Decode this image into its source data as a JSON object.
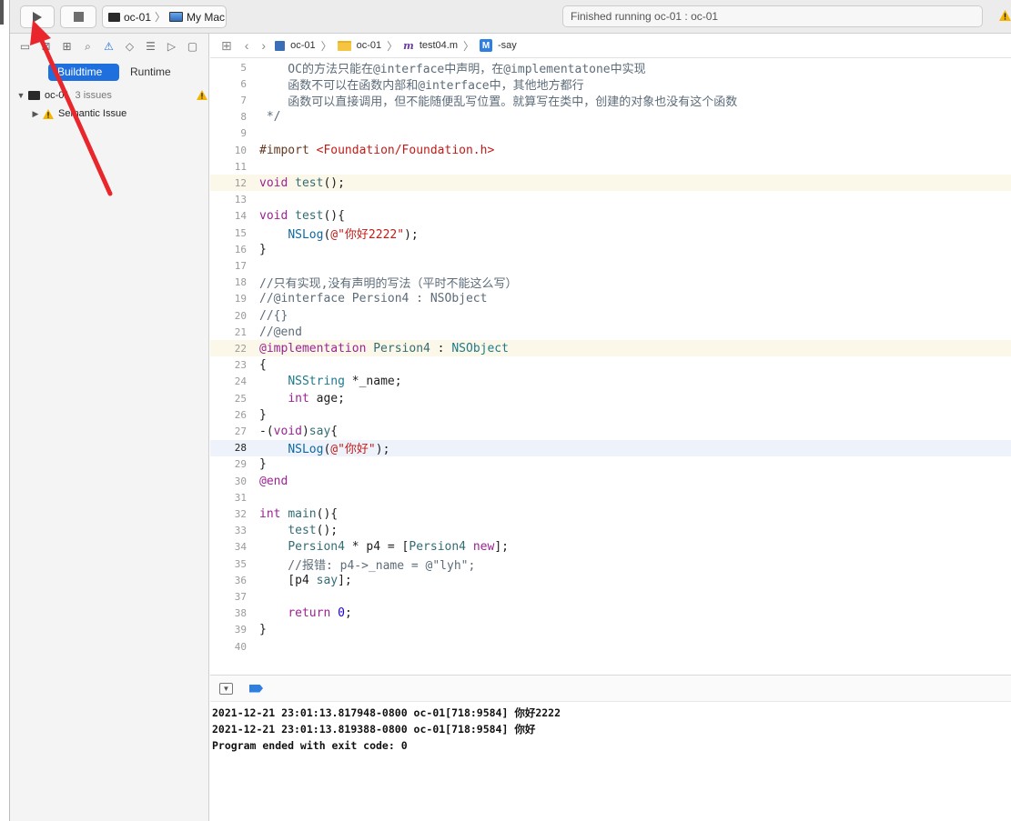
{
  "toolbar": {
    "scheme_target": "oc-01",
    "scheme_device": "My Mac",
    "status": "Finished running oc-01 : oc-01"
  },
  "navigator": {
    "tabs": {
      "buildtime": "Buildtime (3)",
      "runtime": "Runtime"
    },
    "project": {
      "name": "oc-01",
      "issues": "3 issues"
    },
    "issue_group": "Semantic Issue"
  },
  "jumpbar": {
    "crumbs": [
      "oc-01",
      "oc-01",
      "test04.m",
      "-say"
    ]
  },
  "editor": {
    "current_line": 28,
    "lines": [
      {
        "n": "5",
        "t": "    OC的方法只能在@interface中声明，在@implementatone中实现"
      },
      {
        "n": "6",
        "t": "    函数不可以在函数内部和@interface中，其他地方都行"
      },
      {
        "n": "7",
        "t": "    函数可以直接调用，但不能随便乱写位置。就算写在类中，创建的对象也没有这个函数"
      },
      {
        "n": "8",
        "t": " */"
      },
      {
        "n": "9",
        "t": ""
      },
      {
        "n": "10",
        "t": "#import <Foundation/Foundation.h>"
      },
      {
        "n": "11",
        "t": ""
      },
      {
        "n": "12",
        "t": "void test();"
      },
      {
        "n": "13",
        "t": ""
      },
      {
        "n": "14",
        "t": "void test(){"
      },
      {
        "n": "15",
        "t": "    NSLog(@\"你好2222\");"
      },
      {
        "n": "16",
        "t": "}"
      },
      {
        "n": "17",
        "t": ""
      },
      {
        "n": "18",
        "t": "//只有实现,没有声明的写法（平时不能这么写）"
      },
      {
        "n": "19",
        "t": "//@interface Persion4 : NSObject"
      },
      {
        "n": "20",
        "t": "//{}"
      },
      {
        "n": "21",
        "t": "//@end"
      },
      {
        "n": "22",
        "t": "@implementation Persion4 : NSObject"
      },
      {
        "n": "23",
        "t": "{"
      },
      {
        "n": "24",
        "t": "    NSString *_name;"
      },
      {
        "n": "25",
        "t": "    int age;"
      },
      {
        "n": "26",
        "t": "}"
      },
      {
        "n": "27",
        "t": "-(void)say{"
      },
      {
        "n": "28",
        "t": "    NSLog(@\"你好\");"
      },
      {
        "n": "29",
        "t": "}"
      },
      {
        "n": "30",
        "t": "@end"
      },
      {
        "n": "31",
        "t": ""
      },
      {
        "n": "32",
        "t": "int main(){"
      },
      {
        "n": "33",
        "t": "    test();"
      },
      {
        "n": "34",
        "t": "    Persion4 * p4 = [Persion4 new];"
      },
      {
        "n": "35",
        "t": "    //报错: p4->_name = @\"lyh\";"
      },
      {
        "n": "36",
        "t": "    [p4 say];"
      },
      {
        "n": "37",
        "t": ""
      },
      {
        "n": "38",
        "t": "    return 0;"
      },
      {
        "n": "39",
        "t": "}"
      },
      {
        "n": "40",
        "t": ""
      }
    ]
  },
  "console": {
    "lines": [
      "2021-12-21 23:01:13.817948-0800 oc-01[718:9584] 你好2222",
      "2021-12-21 23:01:13.819388-0800 oc-01[718:9584] 你好",
      "Program ended with exit code: 0"
    ]
  },
  "colors": {
    "accent": "#1f6fde",
    "annotation_arrow": "#e8262b",
    "warning": "#f4b400"
  }
}
